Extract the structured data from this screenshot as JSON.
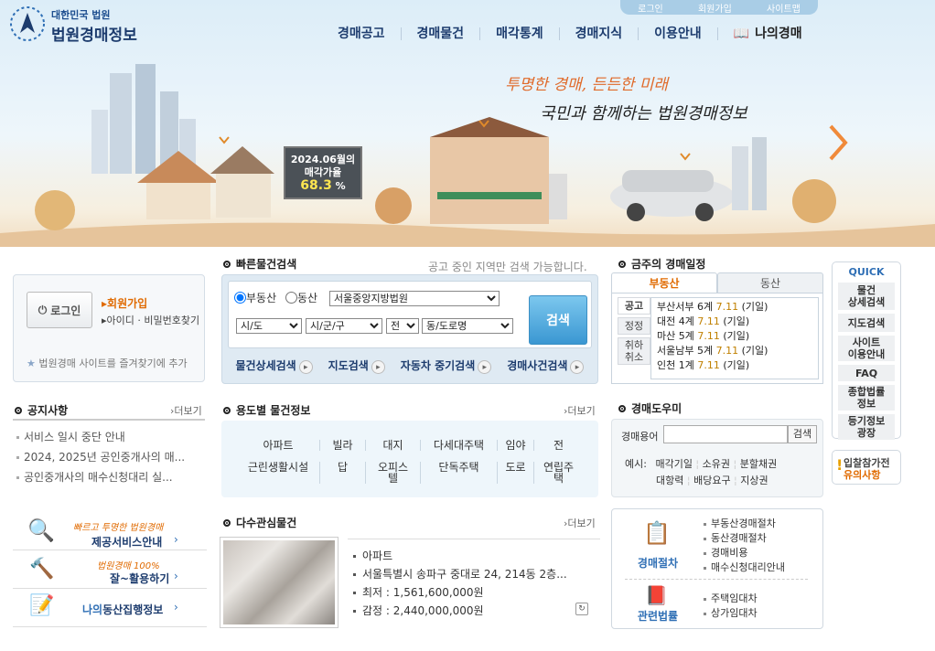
{
  "util": {
    "login": "로그인",
    "join": "회원가입",
    "sitemap": "사이트맵"
  },
  "logo": {
    "sub": "대한민국 법원",
    "main": "법원경매정보"
  },
  "gnb": [
    "경매공고",
    "경매물건",
    "매각통계",
    "경매지식",
    "이용안내",
    "나의경매"
  ],
  "hero": {
    "slogan1": "투명한 경매, 든든한 미래",
    "slogan2": "국민과 함께하는 법원경매정보",
    "rate_period": "2024.06월의",
    "rate_label": "매각가율",
    "rate_value": "68.3",
    "rate_unit": "%"
  },
  "login": {
    "button": "로그인",
    "join": "회원가입",
    "find": "아이디 · 비밀번호찾기",
    "fav": "법원경매 사이트를 즐겨찾기에 추가"
  },
  "search": {
    "title": "빠른물건검색",
    "note": "공고 중인 지역만 검색 가능합니다.",
    "radio_real": "부동산",
    "radio_movable": "동산",
    "court": "서울중앙지방법원",
    "sido": "시/도",
    "sigungu": "시/군/구",
    "jeon": "전",
    "dong": "동/도로명",
    "button": "검색",
    "links": [
      "물건상세검색",
      "지도검색",
      "자동차 중기검색",
      "경매사건검색"
    ]
  },
  "schedule": {
    "title": "금주의 경매일정",
    "tabs": [
      "부동산",
      "동산"
    ],
    "side": [
      "공고",
      "정정",
      "취하",
      "취소"
    ],
    "items": [
      {
        "court": "부산서부 6계",
        "date": "7.11",
        "kind": "(기일)"
      },
      {
        "court": "대전 4계",
        "date": "7.11",
        "kind": "(기일)"
      },
      {
        "court": "마산 5계",
        "date": "7.11",
        "kind": "(기일)"
      },
      {
        "court": "서울남부 5계",
        "date": "7.11",
        "kind": "(기일)"
      },
      {
        "court": "인천 1계",
        "date": "7.11",
        "kind": "(기일)"
      }
    ]
  },
  "quick": {
    "title": "QUICK",
    "items": [
      "물건\n상세검색",
      "지도검색",
      "사이트\n이용안내",
      "FAQ",
      "종합법률\n정보",
      "등기정보\n광장"
    ],
    "notice_line1": "입찰참가전",
    "notice_line2": "유의사항"
  },
  "notice": {
    "title": "공지사항",
    "more": "더보기",
    "items": [
      "서비스 일시 중단 안내",
      "2024, 2025년 공인중개사의 매...",
      "공인중개사의 매수신청대리 실..."
    ]
  },
  "usage": {
    "title": "용도별 물건정보",
    "more": "더보기",
    "row1": [
      "아파트",
      "빌라",
      "대지",
      "다세대주택",
      "임야",
      "전"
    ],
    "row2": [
      "근린생활시설",
      "답",
      "오피스텔",
      "단독주택",
      "도로",
      "연립주택"
    ]
  },
  "popular": {
    "title": "다수관심물건",
    "more": "더보기",
    "type": "아파트",
    "address": "서울특별시 송파구 중대로 24, 214동 2층...",
    "min_label": "최저 : ",
    "min": "1,561,600,000원",
    "appraisal_label": "감정 : ",
    "appraisal": "2,440,000,000원"
  },
  "glossary": {
    "title": "경매도우미",
    "label": "경매용어",
    "button": "검색",
    "example_label": "예시:",
    "examples1": [
      "매각기일",
      "소유권",
      "분할채권"
    ],
    "examples2": [
      "대항력",
      "배당요구",
      "지상권"
    ]
  },
  "procedure": {
    "label1": "경매절차",
    "links1": [
      "부동산경매절차",
      "동산경매절차",
      "경매비용",
      "매수신청대리안내"
    ],
    "label2": "관련법률",
    "links2": [
      "주택임대차",
      "상가임대차"
    ]
  },
  "banners": [
    {
      "small": "빠르고 투명한 법원경매",
      "big": "제공서비스안내"
    },
    {
      "small": "법원경매 100%",
      "big": "잘~활용하기"
    },
    {
      "small": "",
      "big_prefix": "나의",
      "big": "동산집행정보"
    }
  ],
  "colors": {
    "brand": "#1d3c6e",
    "accent": "#e06a00",
    "rate": "#ffe650",
    "button": "#3a97d2"
  }
}
